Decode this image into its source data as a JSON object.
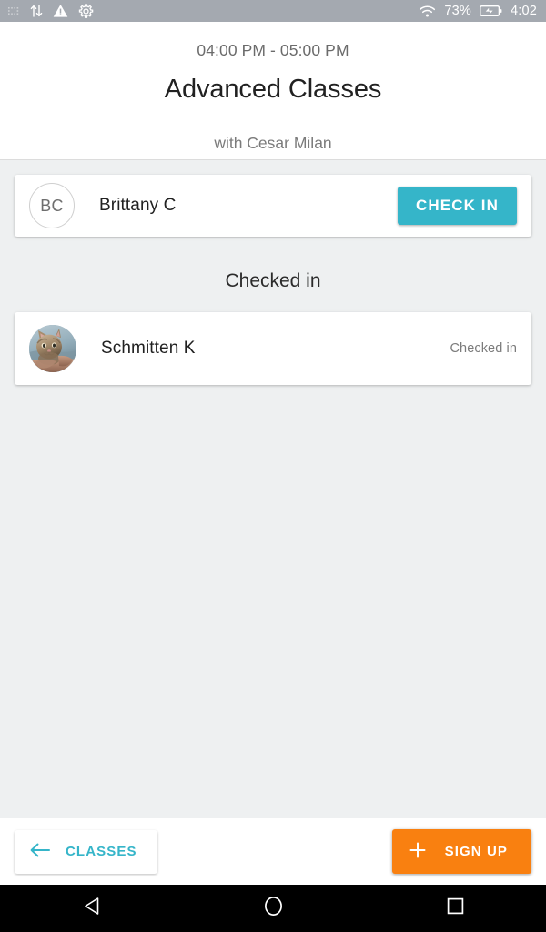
{
  "status_bar": {
    "left_icons": [
      "dots-icon",
      "sync-arrows-icon",
      "warning-triangle-icon",
      "gear-icon"
    ],
    "wifi_icon": "wifi-icon",
    "battery_percent": "73%",
    "battery_icon": "battery-charging-icon",
    "clock": "4:02",
    "background_color": "#a4a9b0"
  },
  "header": {
    "time_range": "04:00 PM - 05:00 PM",
    "title": "Advanced Classes",
    "instructor": "with Cesar Milan"
  },
  "pending": {
    "avatar_initials": "BC",
    "name": "Brittany C",
    "check_in_label": "CHECK IN",
    "check_in_color": "#35b5c9"
  },
  "checked_in_section": {
    "heading": "Checked in",
    "rows": [
      {
        "avatar_type": "photo",
        "avatar_alt": "kitten-photo",
        "name": "Schmitten K",
        "status": "Checked in"
      }
    ]
  },
  "bottom_bar": {
    "back_icon": "arrow-left-icon",
    "classes_label": "CLASSES",
    "classes_color": "#35b5c9",
    "plus_icon": "plus-icon",
    "signup_label": "SIGN UP",
    "signup_color": "#f98010"
  },
  "nav_bar": {
    "back_icon": "triangle-back-icon",
    "home_icon": "circle-home-icon",
    "recents_icon": "square-recents-icon"
  }
}
